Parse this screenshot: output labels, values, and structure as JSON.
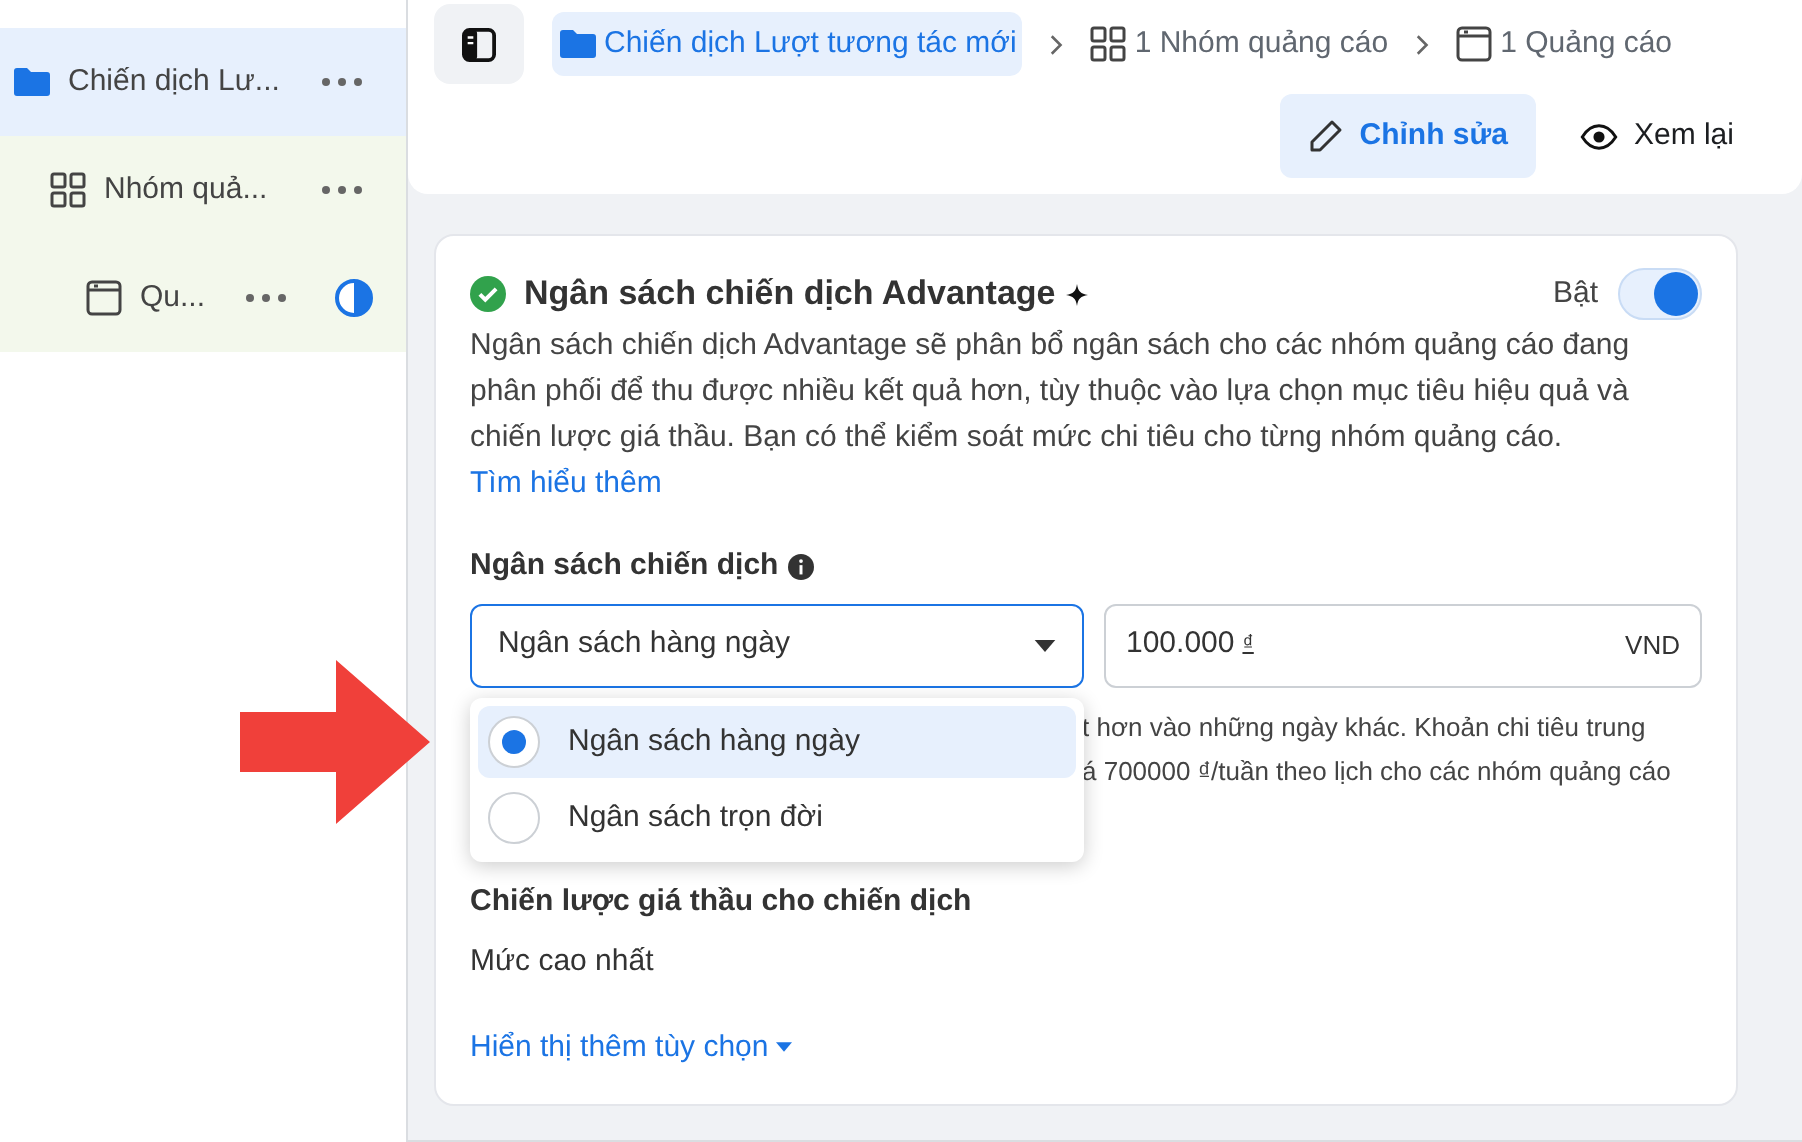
{
  "sidebar": {
    "items": [
      {
        "kind": "campaign",
        "label": "Chiến dịch Lư...",
        "selected": true,
        "status": false
      },
      {
        "kind": "adset",
        "label": "Nhóm quả...",
        "selected": false,
        "status": false
      },
      {
        "kind": "ad",
        "label": "Qu...",
        "selected": false,
        "status": true
      }
    ]
  },
  "breadcrumbs": [
    {
      "kind": "campaign",
      "label": "Chiến dịch Lượt tương tác mới",
      "selected": true
    },
    {
      "kind": "adset",
      "label": "1 Nhóm quảng cáo",
      "selected": false
    },
    {
      "kind": "ad",
      "label": "1 Quảng cáo",
      "selected": false
    }
  ],
  "actions": [
    {
      "kind": "edit",
      "label": "Chỉnh sửa",
      "selected": true
    },
    {
      "kind": "review",
      "label": "Xem lại",
      "selected": false
    }
  ],
  "card": {
    "title": "Ngân sách chiến dịch Advantage",
    "toggle_label": "Bật",
    "on": true,
    "description": "Ngân sách chiến dịch Advantage sẽ phân bổ ngân sách cho các nhóm quảng cáo đang phân phối để thu được nhiều kết quả hơn, tùy thuộc vào lựa chọn mục tiêu hiệu quả và chiến lược giá thầu. Bạn có thể kiểm soát mức chi tiêu cho từng nhóm quảng cáo.",
    "link": "Tìm hiểu thêm",
    "budget_label": "Ngân sách chiến dịch",
    "budget_type": "Ngân sách hàng ngày",
    "amount": "100.000",
    "currency_symbol": "₫",
    "currency": "VND",
    "note_lines": [
      "t hơn vào những ngày khác. Khoản chi tiêu trung",
      "á 700000 ₫/tuần theo lịch cho các nhóm quảng cáo"
    ],
    "bid_label": "Chiến lược giá thầu cho chiến dịch",
    "bid_value": "Mức cao nhất",
    "more_link": "Hiển thị thêm tùy chọn"
  },
  "dropdown": {
    "options": [
      {
        "label": "Ngân sách hàng ngày",
        "selected": true
      },
      {
        "label": "Ngân sách trọn đời",
        "selected": false
      }
    ]
  }
}
